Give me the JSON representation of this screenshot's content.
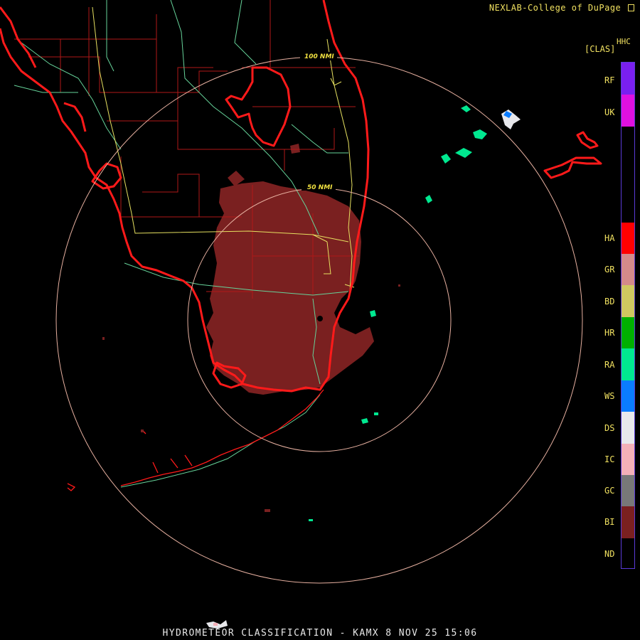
{
  "header": {
    "credit": "NEXLAB-College of DuPage",
    "product_code": "HHC",
    "product_sub": "[CLAS]"
  },
  "footer": {
    "title": "HYDROMETEOR CLASSIFICATION - KAMX 8 NOV 25 15:06"
  },
  "range_rings": [
    {
      "label": "50 NMI"
    },
    {
      "label": "100 NMI"
    }
  ],
  "legend": {
    "items": [
      {
        "code": "RF",
        "color": "#7a1ff0"
      },
      {
        "code": "UK",
        "color": "#e010e0"
      },
      {
        "code": "HA",
        "color": "#ff0000"
      },
      {
        "code": "GR",
        "color": "#d48a8a"
      },
      {
        "code": "BD",
        "color": "#cfc860"
      },
      {
        "code": "HR",
        "color": "#00b000"
      },
      {
        "code": "RA",
        "color": "#00e890"
      },
      {
        "code": "WS",
        "color": "#0a7cff"
      },
      {
        "code": "DS",
        "color": "#e8e8ec"
      },
      {
        "code": "IC",
        "color": "#f4b0b8"
      },
      {
        "code": "GC",
        "color": "#787878"
      },
      {
        "code": "BI",
        "color": "#7a2020"
      },
      {
        "code": "ND",
        "color": "#000000"
      }
    ]
  },
  "colors": {
    "coastline": "#ff1a1a",
    "county_lines": "#b01818",
    "roads": "#66d39a",
    "highways": "#e6e060",
    "rings": "#e7b0a0",
    "biological_echo": "#7a2020"
  }
}
